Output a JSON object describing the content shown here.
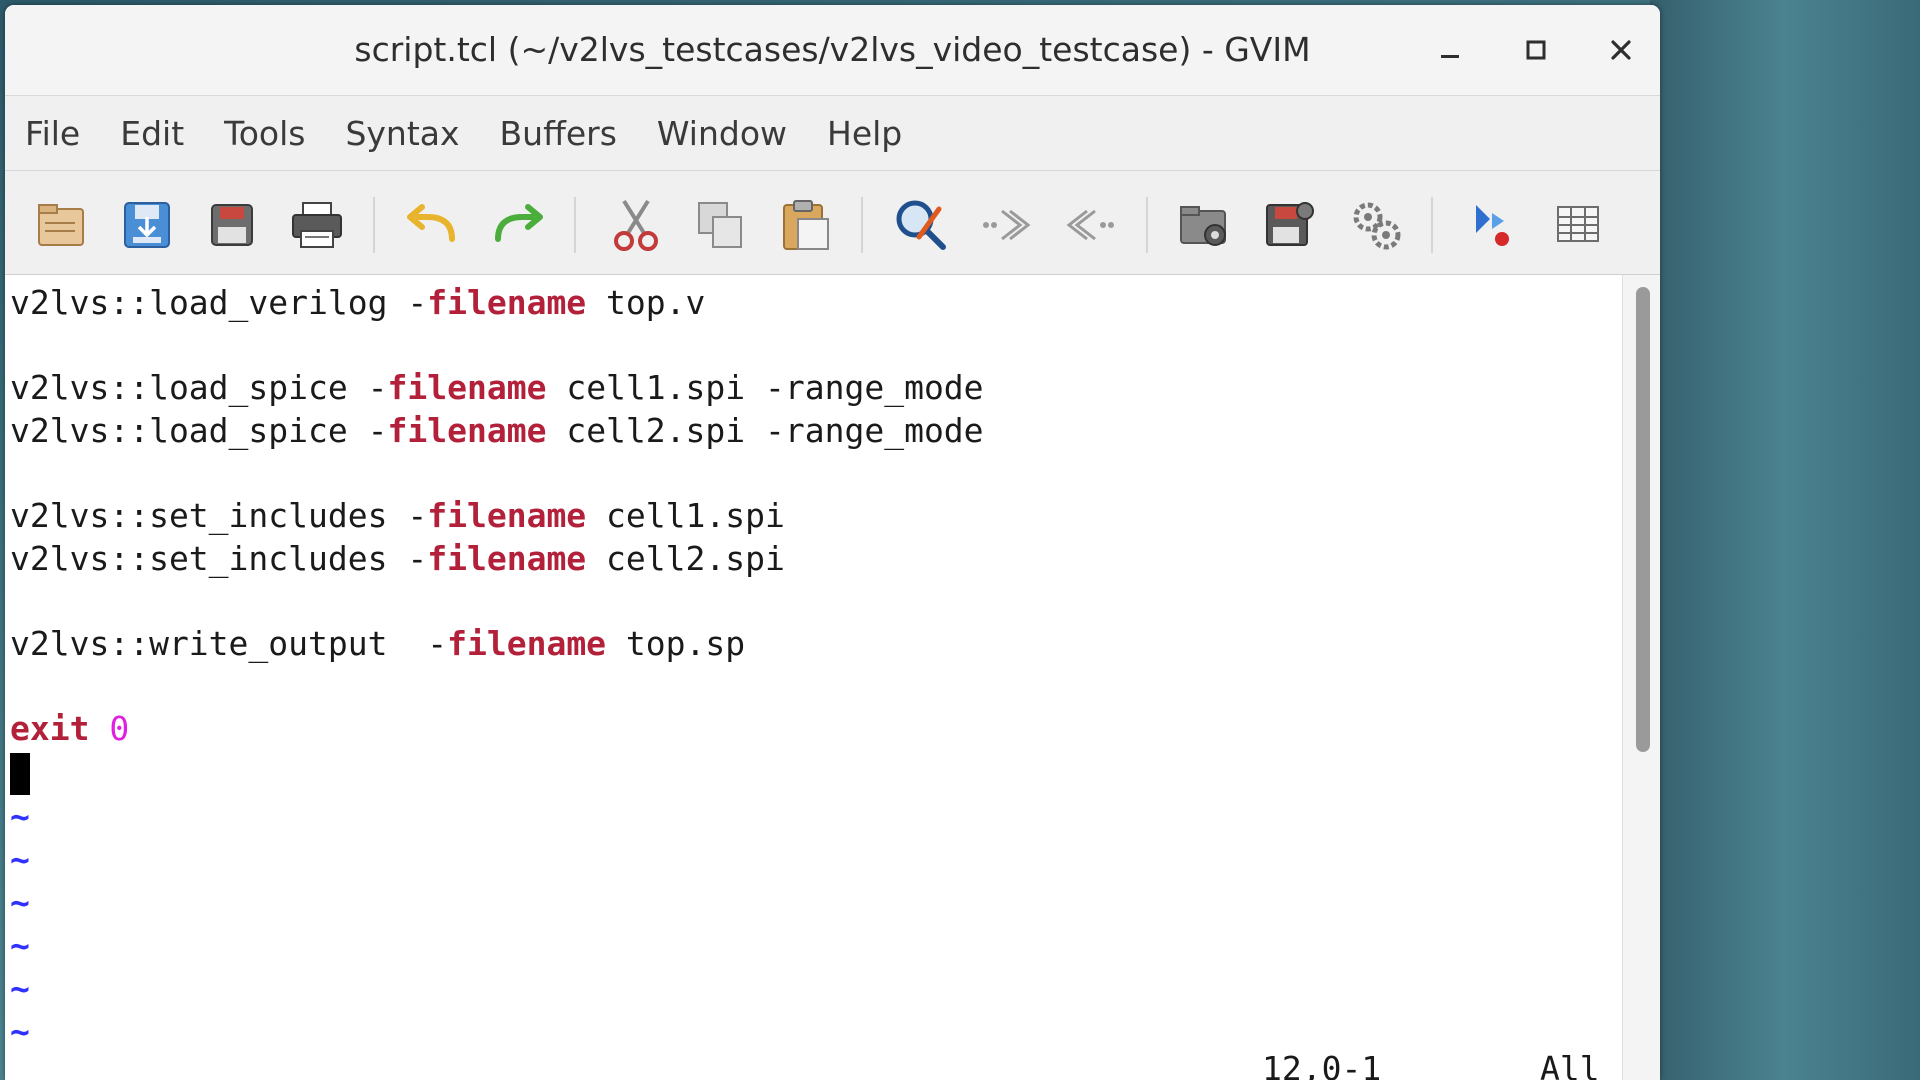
{
  "window": {
    "title": "script.tcl (~/v2lvs_testcases/v2lvs_video_testcase) - GVIM",
    "minimize_icon": "minimize-icon",
    "maximize_icon": "maximize-icon",
    "close_icon": "close-icon"
  },
  "menu": [
    "File",
    "Edit",
    "Tools",
    "Syntax",
    "Buffers",
    "Window",
    "Help"
  ],
  "toolbar": {
    "buttons": [
      "open-icon",
      "save-icon",
      "save-all-icon",
      "print-icon",
      "undo-icon",
      "redo-icon",
      "cut-icon",
      "copy-icon",
      "paste-icon",
      "find-replace-icon",
      "find-next-icon",
      "find-prev-icon",
      "load-session-icon",
      "save-session-icon",
      "run-script-icon",
      "make-icon",
      "tags-icon"
    ]
  },
  "editor": {
    "lines": [
      {
        "cmd": "v2lvs::load_verilog ",
        "dash": "-",
        "kw": "filename",
        "rest": " top.v"
      },
      {
        "cmd": "v2lvs::load_spice ",
        "dash": "-",
        "kw": "filename",
        "rest": " cell1.spi -range_mode"
      },
      {
        "cmd": "v2lvs::load_spice ",
        "dash": "-",
        "kw": "filename",
        "rest": " cell2.spi -range_mode"
      },
      {
        "cmd": "v2lvs::set_includes ",
        "dash": "-",
        "kw": "filename",
        "rest": " cell1.spi"
      },
      {
        "cmd": "v2lvs::set_includes ",
        "dash": "-",
        "kw": "filename",
        "rest": " cell2.spi"
      },
      {
        "cmd": "v2lvs::write_output  ",
        "dash": "-",
        "kw": "filename",
        "rest": " top.sp"
      }
    ],
    "exit_kw": "exit",
    "exit_num": "0",
    "tilde": "~",
    "cursor_position": "12,0-1",
    "scroll_position": "All"
  },
  "colors": {
    "keyword": "#b3203a",
    "number": "#e020e0",
    "tilde": "#3030ff"
  }
}
